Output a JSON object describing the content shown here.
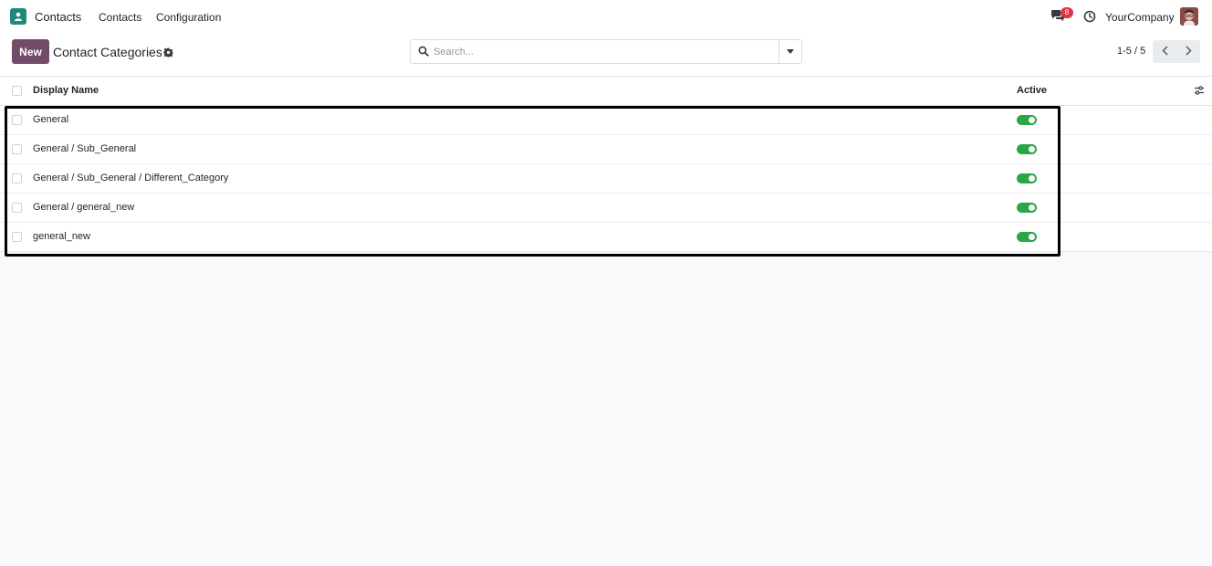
{
  "navbar": {
    "app_name": "Contacts",
    "menu": [
      "Contacts",
      "Configuration"
    ],
    "chat_badge_count": "8",
    "company": "YourCompany",
    "accent_color": "#714b67",
    "app_icon_color": "#1c8a77"
  },
  "control_panel": {
    "new_label": "New",
    "title": "Contact Categories",
    "search_placeholder": "Search...",
    "pager_value": "1-5 / 5"
  },
  "table": {
    "columns": {
      "name": "Display Name",
      "active": "Active"
    },
    "rows": [
      {
        "name": "General",
        "active": true
      },
      {
        "name": "General / Sub_General",
        "active": true
      },
      {
        "name": "General / Sub_General / Different_Category",
        "active": true
      },
      {
        "name": "General / general_new",
        "active": true
      },
      {
        "name": "general_new",
        "active": true
      }
    ],
    "toggle_on_color": "#28a745"
  },
  "icons": {
    "app": "contacts-app-icon",
    "chat": "chat-icon",
    "clock": "activity-clock-icon",
    "gear": "gear-icon",
    "search": "search-icon",
    "dropdown": "caret-down-icon",
    "prev": "chevron-left-icon",
    "next": "chevron-right-icon",
    "optional_columns": "sliders-icon"
  }
}
